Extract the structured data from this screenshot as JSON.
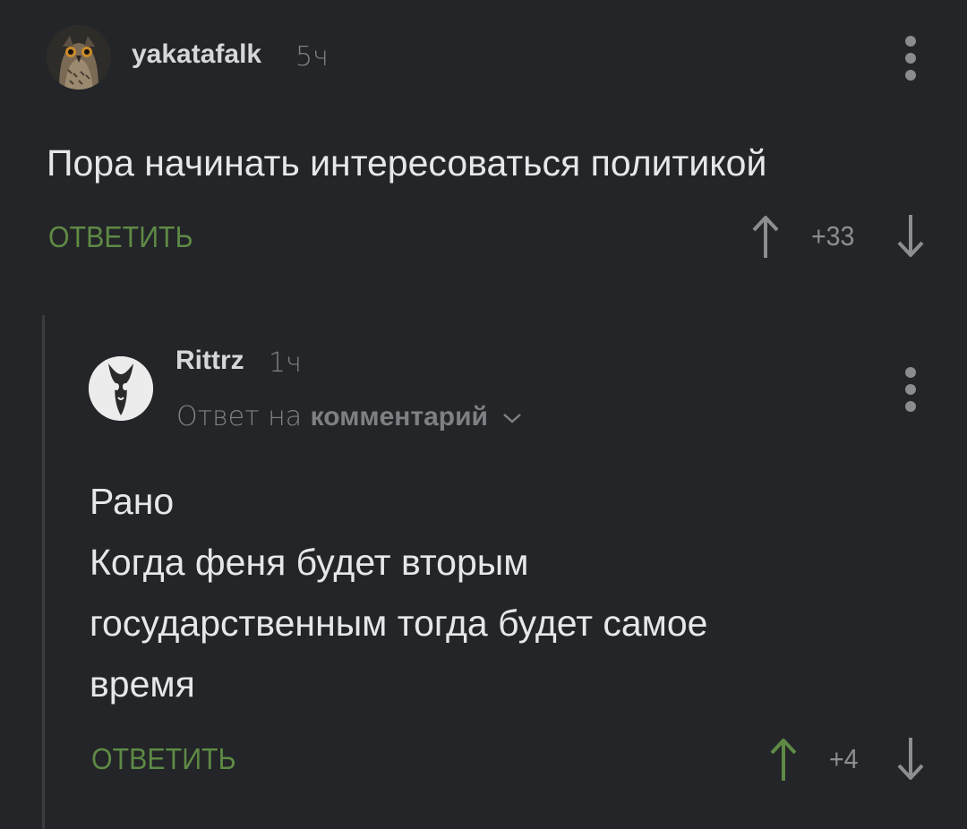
{
  "comments": [
    {
      "username": "yakatafalk",
      "time": "5ч",
      "text": "Пора начинать интересоваться политикой",
      "reply_label": "ОТВЕТИТЬ",
      "rating": "+33",
      "upvoted": false
    },
    {
      "username": "Rittrz",
      "time": "1ч",
      "reply_to_prefix": "Ответ на",
      "reply_to_link": "комментарий",
      "text_lines": [
        "Рано",
        "Когда феня будет вторым",
        "государственным тогда будет самое",
        "время"
      ],
      "reply_label": "ОТВЕТИТЬ",
      "rating": "+4",
      "upvoted": true
    }
  ],
  "icons": {
    "menu": "kebab-menu-icon",
    "upvote": "arrow-up-icon",
    "downvote": "arrow-down-icon",
    "expand": "chevron-down-icon"
  },
  "colors": {
    "background": "#232528",
    "reply_button": "#5e8a45",
    "upvoted_arrow": "#5e8a45",
    "neutral_arrow": "#8c8f92"
  }
}
